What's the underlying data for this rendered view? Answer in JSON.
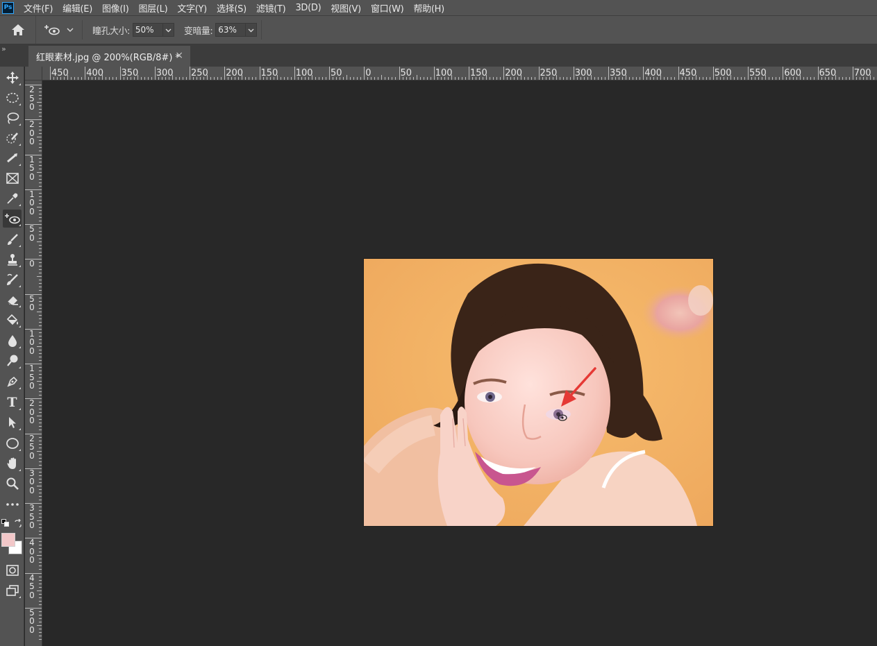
{
  "app": {
    "logo": "Ps"
  },
  "menu": [
    "文件(F)",
    "编辑(E)",
    "图像(I)",
    "图层(L)",
    "文字(Y)",
    "选择(S)",
    "滤镜(T)",
    "3D(D)",
    "视图(V)",
    "窗口(W)",
    "帮助(H)"
  ],
  "options": {
    "pupil_size_label": "瞳孔大小:",
    "pupil_size_value": "50%",
    "darken_label": "变暗量:",
    "darken_value": "63%"
  },
  "tab": {
    "title": "红眼素材.jpg @ 200%(RGB/8#) *",
    "close": "×"
  },
  "panel_collapse": "»",
  "ruler_top_labels": [
    "450",
    "400",
    "350",
    "300",
    "250",
    "200",
    "150",
    "100",
    "50",
    "0",
    "50",
    "100",
    "150",
    "200",
    "250",
    "300",
    "350",
    "400",
    "450",
    "500",
    "550",
    "600",
    "650",
    "700"
  ],
  "ruler_left_labels": [
    "250",
    "200",
    "150",
    "100",
    "50",
    "0",
    "50",
    "100",
    "150",
    "200",
    "250",
    "300",
    "350",
    "400",
    "450",
    "500"
  ],
  "tools": [
    "move-tool",
    "marquee-tool",
    "lasso-tool",
    "quick-select-tool",
    "crop-tool",
    "frame-tool",
    "eyedropper-tool",
    "red-eye-tool",
    "brush-tool",
    "stamp-tool",
    "history-brush-tool",
    "eraser-tool",
    "paint-bucket-tool",
    "blur-tool",
    "dodge-tool",
    "pen-tool",
    "type-tool",
    "path-select-tool",
    "ellipse-tool",
    "hand-tool",
    "zoom-tool",
    "more-tools"
  ],
  "colors": {
    "foreground": "#f2c7c8",
    "background": "#ffffff",
    "annotation_arrow": "#e53935",
    "ps_blue": "#31a8ff"
  },
  "type_tool_glyph": "T"
}
